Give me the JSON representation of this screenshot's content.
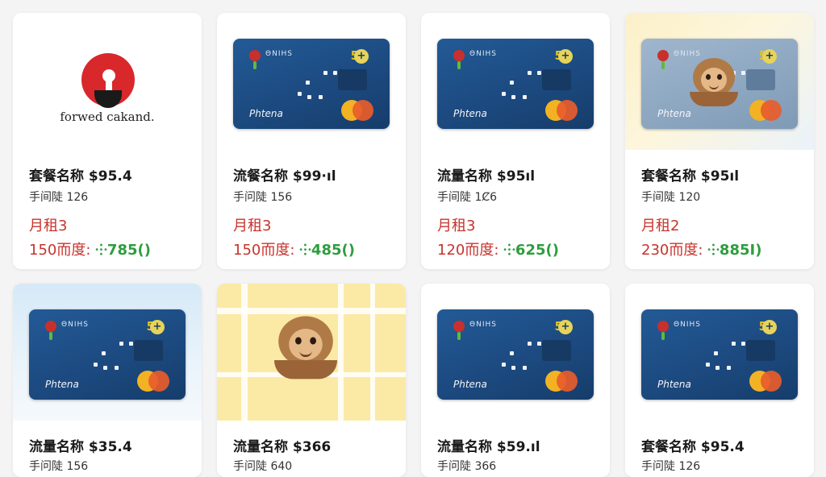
{
  "cards": [
    {
      "title": "套餐名称 $95.4",
      "sub": "手间陡 126",
      "rent": "月租3",
      "price_label": "150而度:",
      "price_value": "⸭785()",
      "banner": "logo",
      "logo_text": "forwed cakand."
    },
    {
      "title": "流餐名称 $99·ıl",
      "sub": "手问陡 156",
      "rent": "月租3",
      "price_label": "150而度:",
      "price_value": "⸭485()",
      "banner": "bankcard",
      "card_brand": "ΘNIHS",
      "card_name": "Phtena",
      "card_logo": "5"
    },
    {
      "title": "流量名称 $95ıl",
      "sub": "手间陡 1Ȼ6",
      "rent": "月租3",
      "price_label": "120而度:",
      "price_value": "⸭625()",
      "banner": "bankcard",
      "card_brand": "ΘNIHS",
      "card_name": "Phtena",
      "card_logo": "5"
    },
    {
      "title": "套餐名称 $95ıl",
      "sub": "手间陡 120",
      "rent": "月租2",
      "price_label": "230而度:",
      "price_value": "⸭885I)",
      "banner": "bankcard-mascot",
      "card_brand": "ΘNIHS",
      "card_name": "Phtena",
      "card_logo": "5"
    },
    {
      "title": "流量名称 $35.4",
      "sub": "手问陡 156",
      "banner": "bankcard",
      "card_brand": "ΘNIHS",
      "card_name": "Phtena",
      "card_logo": "5"
    },
    {
      "title": "流量名称 $366",
      "sub": "手问陡 640",
      "banner": "mascot"
    },
    {
      "title": "流量名称 $59.ıl",
      "sub": "手问陡 366",
      "banner": "bankcard",
      "card_brand": "ΘNIHS",
      "card_name": "Phtena",
      "card_logo": "5"
    },
    {
      "title": "套餐名称 $95.4",
      "sub": "手问陡 126",
      "banner": "bankcard",
      "card_brand": "ΘNIHS",
      "card_name": "Phtena",
      "card_logo": "5"
    }
  ],
  "colors": {
    "accent_red": "#c8332c",
    "accent_green": "#2e9d3f",
    "card_blue": "#1c4a80"
  }
}
